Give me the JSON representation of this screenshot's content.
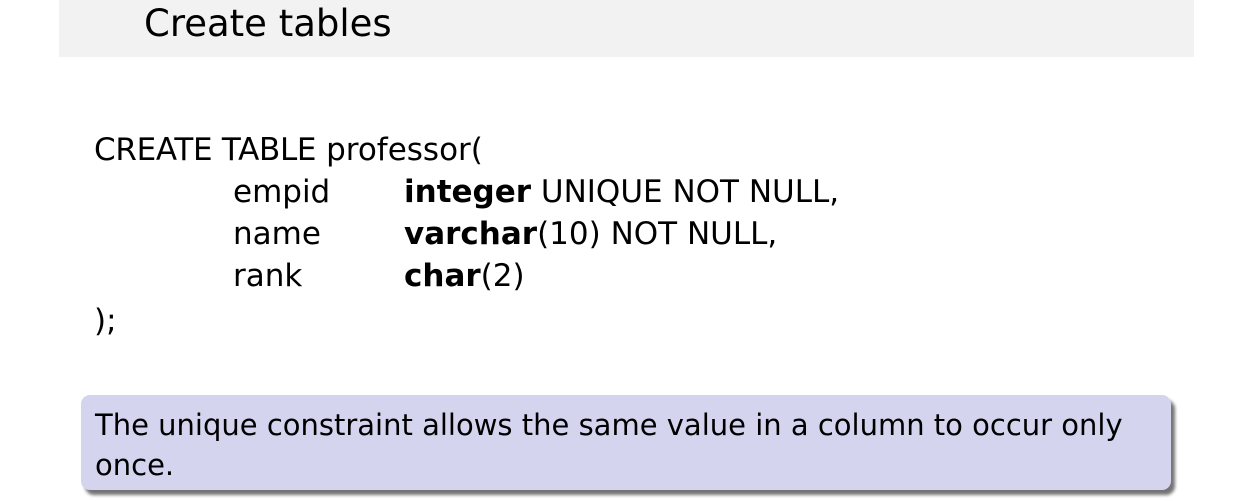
{
  "slide": {
    "title": "Create tables"
  },
  "code": {
    "open_line_prefix": "CREATE TABLE",
    "open_line_suffix": "professor(",
    "columns": [
      {
        "name": "empid",
        "type_bold": "integer",
        "type_rest": " UNIQUE NOT NULL,"
      },
      {
        "name": "name",
        "type_bold": "varchar",
        "type_rest": "(10) NOT NULL,"
      },
      {
        "name": "rank",
        "type_bold": "char",
        "type_rest": "(2)"
      }
    ],
    "close_line": ");"
  },
  "note": {
    "text": "The unique constraint allows the same value in a column to occur only once.",
    "background_color": "#d4d4ee"
  }
}
